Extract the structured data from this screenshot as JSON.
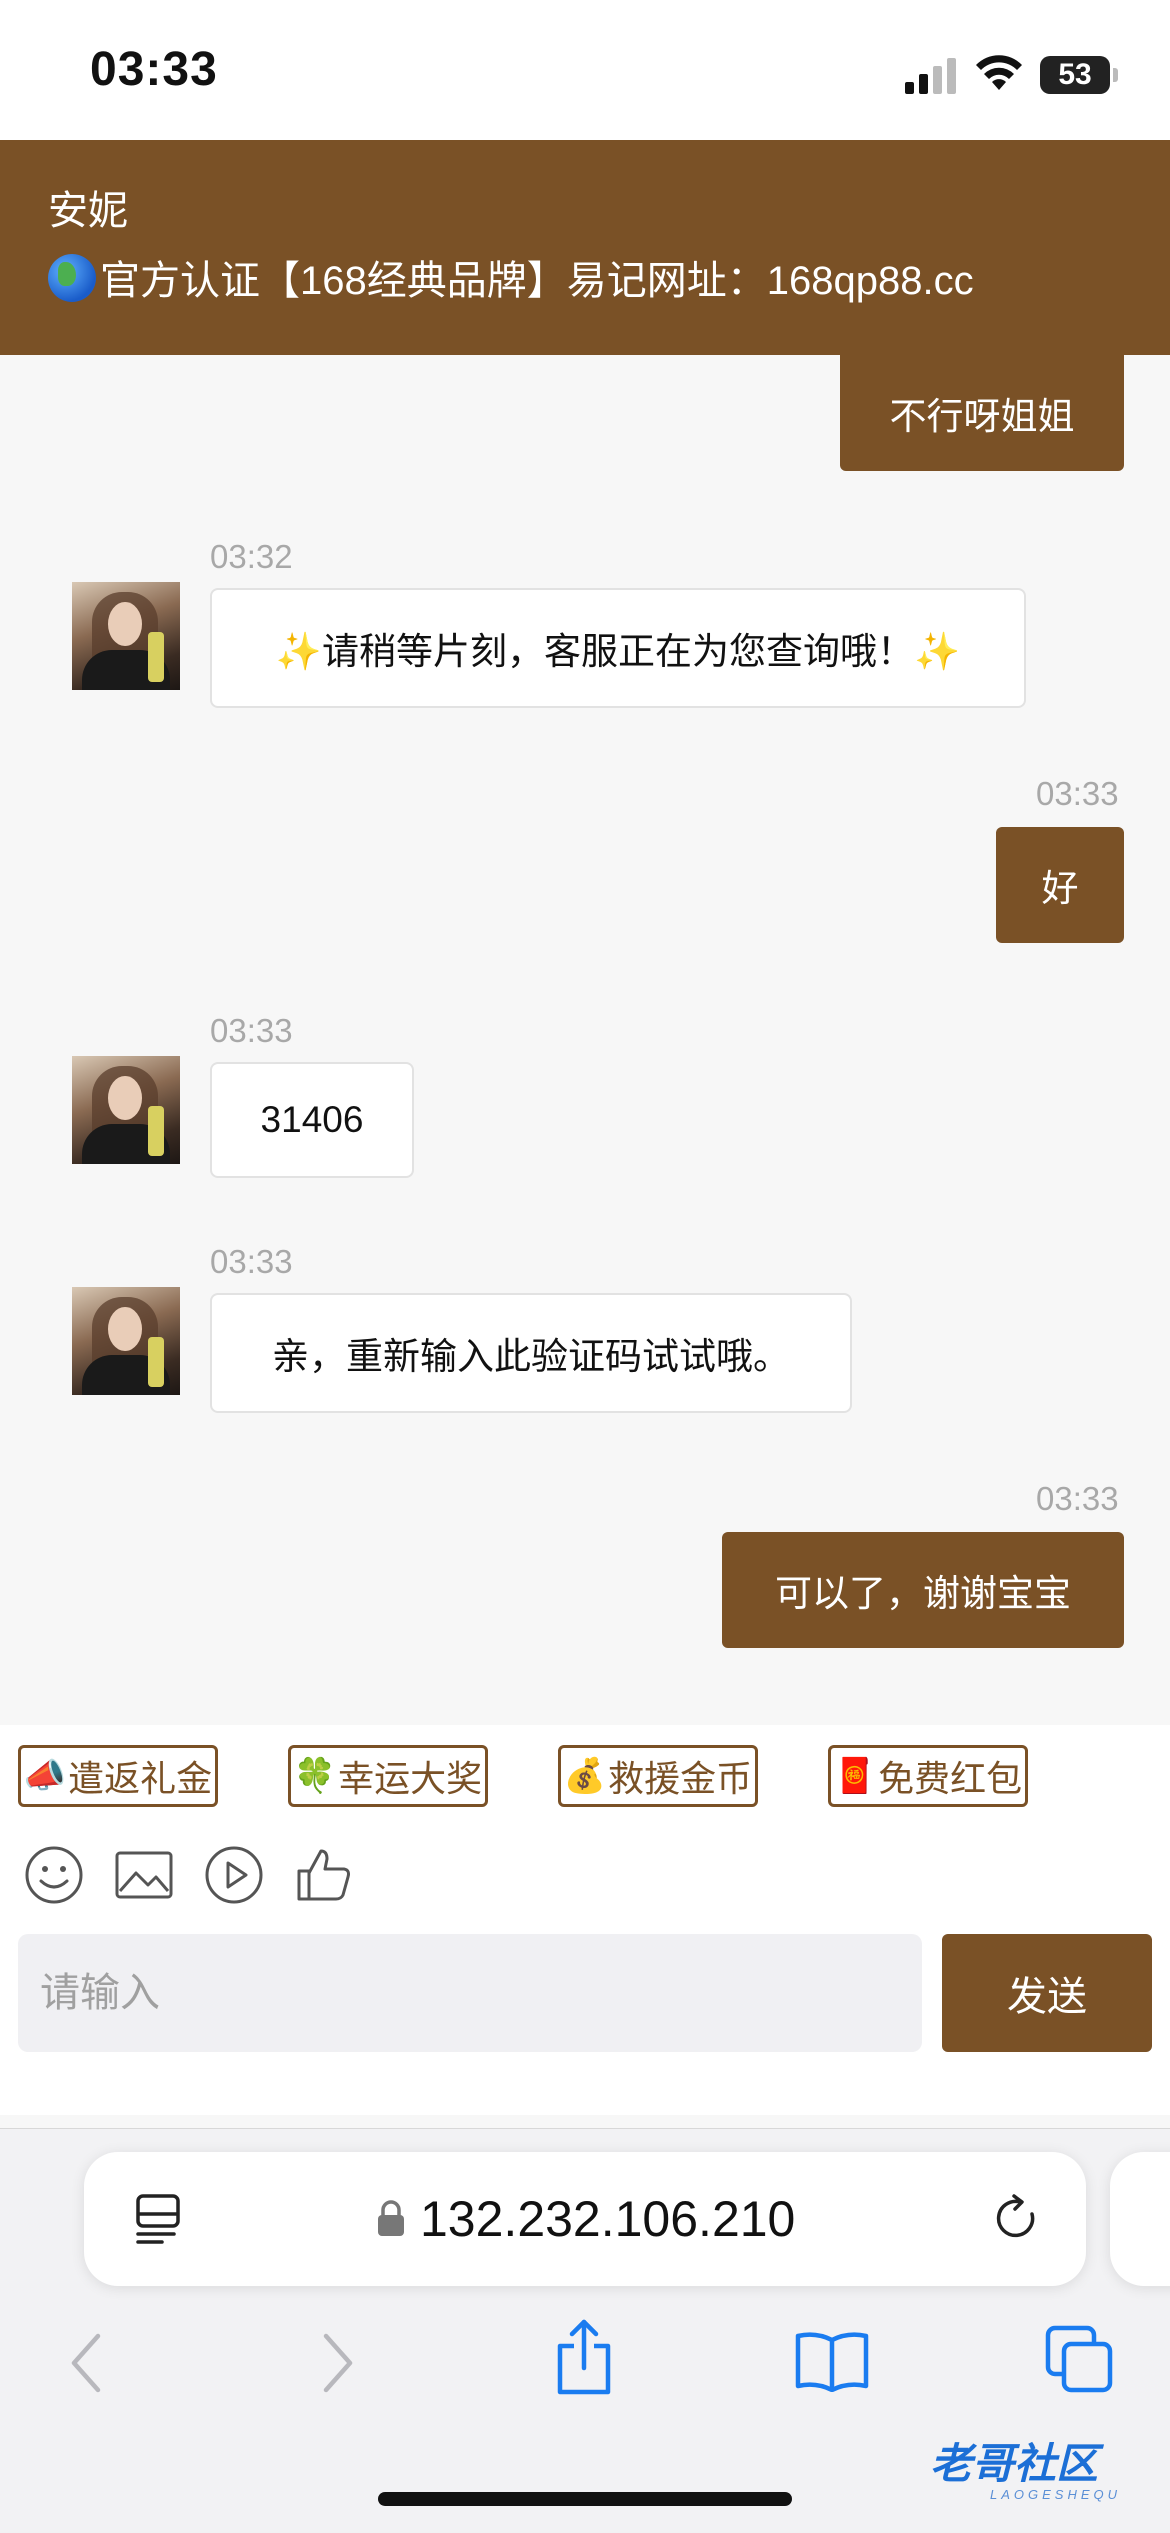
{
  "status_bar": {
    "time": "03:33",
    "battery": "53"
  },
  "header": {
    "name": "安妮",
    "notice": "官方认证【168经典品牌】易记网址：168qp88.cc"
  },
  "messages": [
    {
      "side": "out",
      "time": "",
      "text": "不行呀姐姐"
    },
    {
      "side": "in",
      "time": "03:32",
      "text": "✨请稍等片刻，客服正在为您查询哦！✨"
    },
    {
      "side": "out",
      "time": "03:33",
      "text": "好"
    },
    {
      "side": "in",
      "time": "03:33",
      "text": "31406"
    },
    {
      "side": "in",
      "time": "03:33",
      "text": "亲，重新输入此验证码试试哦。"
    },
    {
      "side": "out",
      "time": "03:33",
      "text": "可以了，谢谢宝宝"
    }
  ],
  "quick_tags": [
    {
      "emoji": "📣",
      "label": "遣返礼金"
    },
    {
      "emoji": "🍀",
      "label": "幸运大奖"
    },
    {
      "emoji": "💰",
      "label": "救援金币"
    },
    {
      "emoji": "🧧",
      "label": "免费红包"
    }
  ],
  "toolbar_icons": [
    "emoji-icon",
    "image-icon",
    "video-icon",
    "thumbs-up-icon"
  ],
  "input": {
    "placeholder": "请输入",
    "value": ""
  },
  "send_label": "发送",
  "browser": {
    "url": "132.232.106.210"
  },
  "watermark": {
    "text": "老哥社区",
    "sub": "LAOGESHEQU"
  },
  "colors": {
    "brand": "#7a5126",
    "link_blue": "#1a7cf0"
  }
}
